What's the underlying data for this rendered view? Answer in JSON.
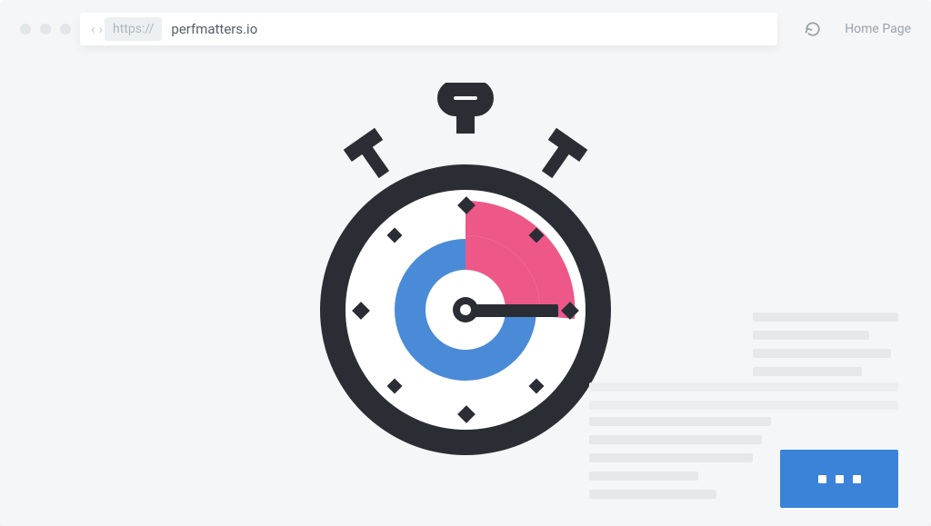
{
  "browser": {
    "scheme": "https://",
    "url": "perfmatters.io",
    "page_label": "Home Page"
  },
  "colors": {
    "accent_blue": "#3b82d9",
    "accent_pink": "#ed5888",
    "ink": "#2a2e34"
  }
}
